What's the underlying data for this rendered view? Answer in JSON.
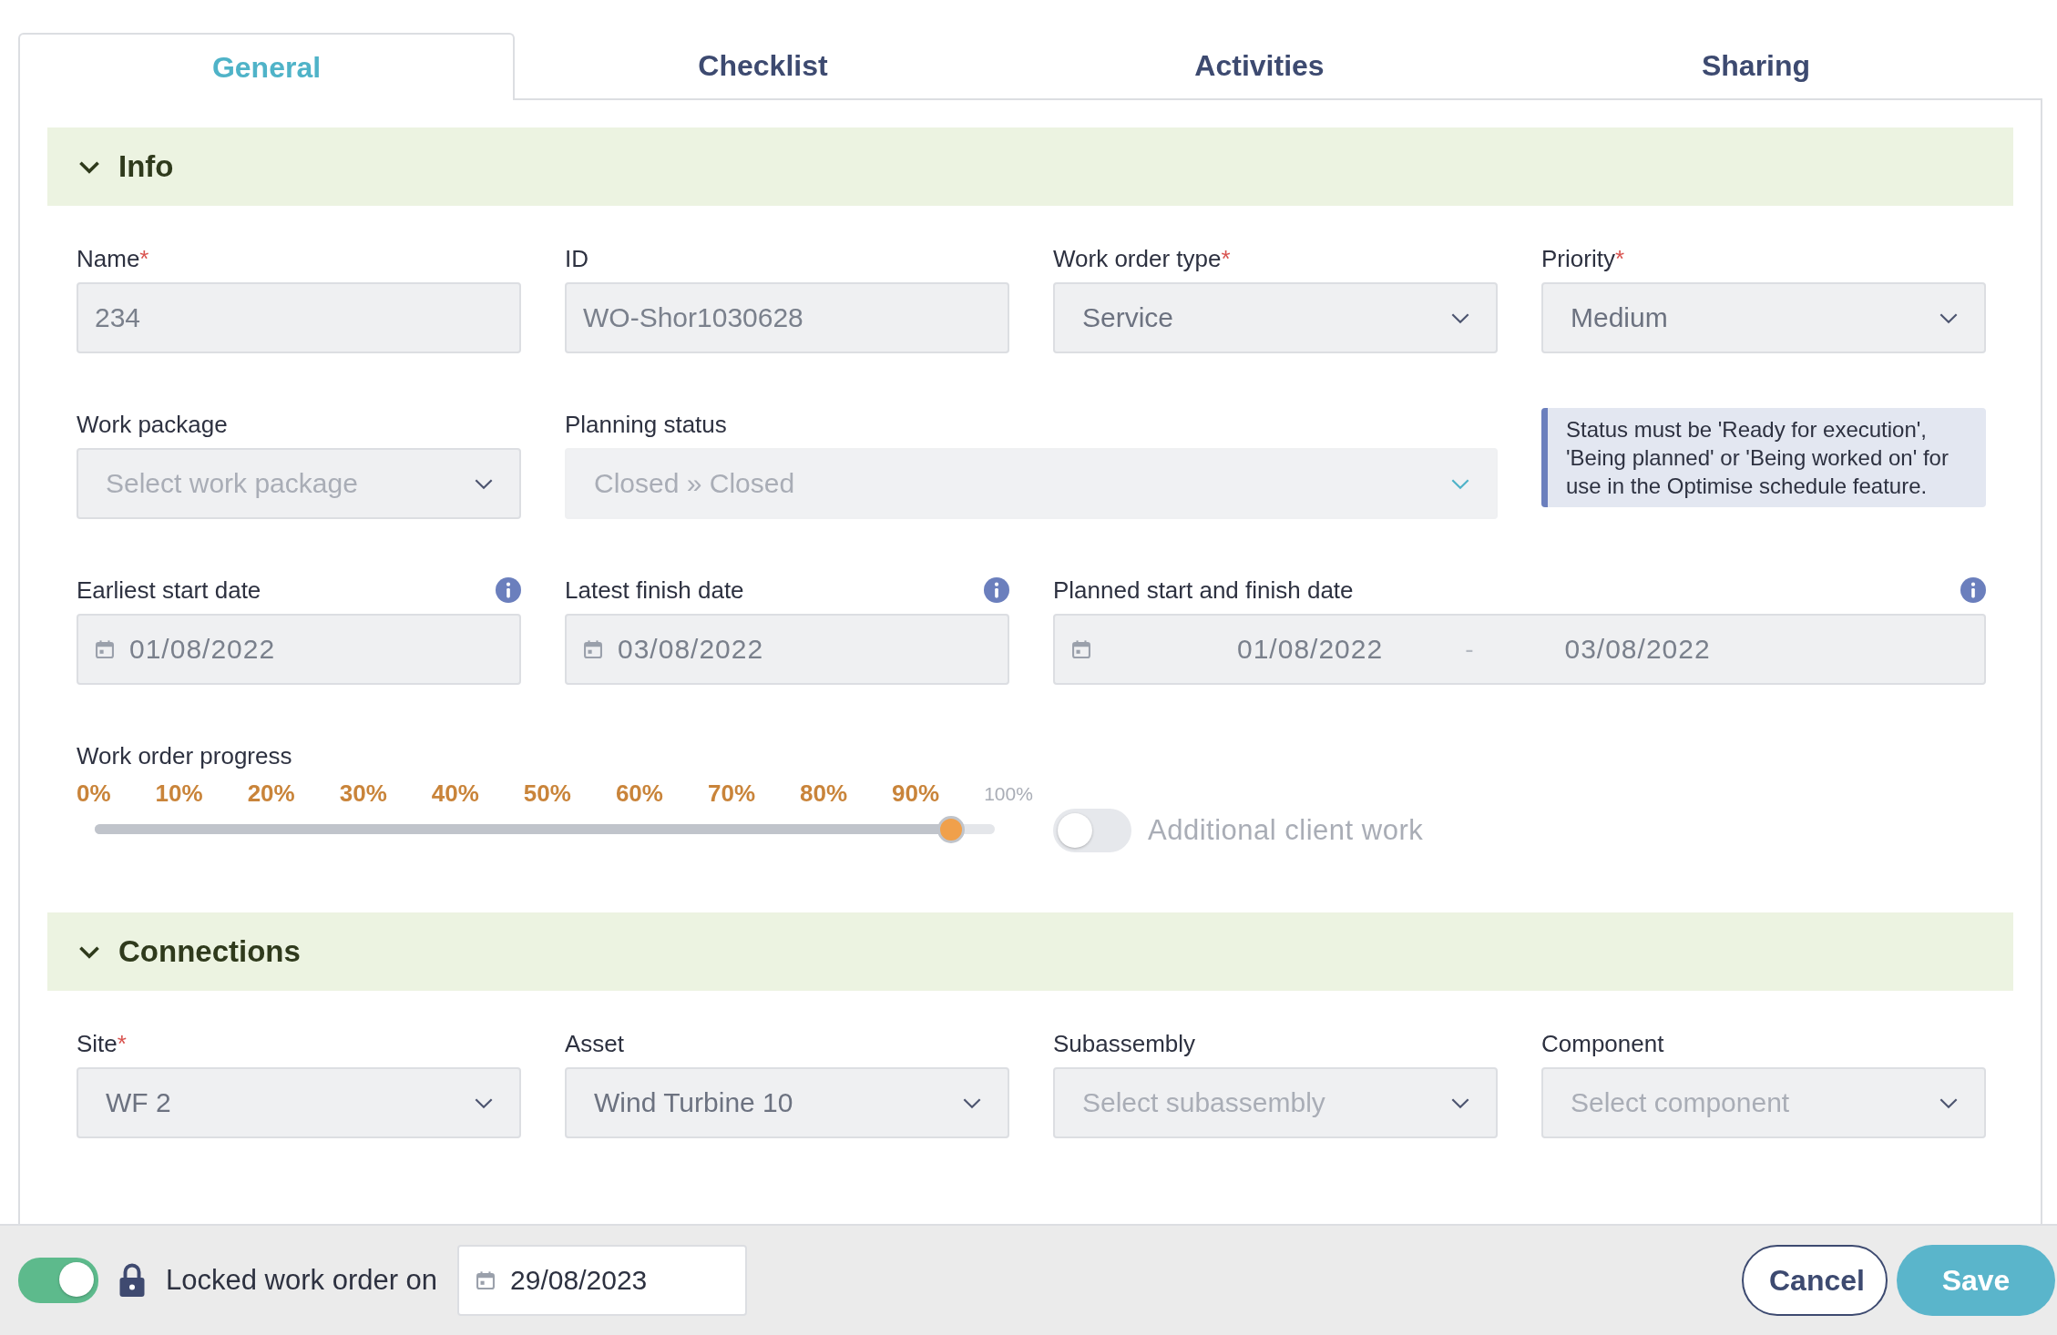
{
  "tabs": [
    {
      "label": "General",
      "selected": true
    },
    {
      "label": "Checklist",
      "selected": false
    },
    {
      "label": "Activities",
      "selected": false
    },
    {
      "label": "Sharing",
      "selected": false
    }
  ],
  "sections": [
    {
      "title": "Info",
      "expanded": true,
      "fields": [
        {
          "kind": "text",
          "label": "Name",
          "required_mark": "*",
          "value": "234"
        },
        {
          "kind": "text",
          "label": "ID",
          "value": "WO-Shor1030628"
        },
        {
          "kind": "select",
          "label": "Work order type",
          "required_mark": "*",
          "value": "Service",
          "disabled": false
        },
        {
          "kind": "select",
          "label": "Priority",
          "required_mark": "*",
          "value": "Medium",
          "disabled": false
        },
        {
          "kind": "select",
          "label": "Work package",
          "placeholder": "Select work package",
          "disabled": false
        },
        {
          "kind": "status_select",
          "label": "Planning status",
          "value": "Closed » Closed",
          "disabled": true
        },
        {
          "kind": "note",
          "text": "Status must be 'Ready for execution', 'Being planned' or 'Being worked on' for use in the Optimise schedule feature."
        },
        {
          "kind": "date",
          "label": "Earliest start date",
          "info_icon": true,
          "value": "01/08/2022"
        },
        {
          "kind": "date",
          "label": "Latest finish date",
          "info_icon": true,
          "value": "03/08/2022"
        },
        {
          "kind": "daterange",
          "label": "Planned start and finish date",
          "info_icon": true,
          "from": "01/08/2022",
          "separator": "-",
          "to": "03/08/2022"
        },
        {
          "kind": "progress",
          "label": "Work order progress",
          "level": 0.95,
          "ticks": [
            "0%",
            "10%",
            "20%",
            "30%",
            "40%",
            "50%",
            "60%",
            "70%",
            "80%",
            "90%",
            "100%"
          ]
        },
        {
          "kind": "toggle",
          "label": "Additional client work",
          "on": false
        }
      ]
    },
    {
      "title": "Connections",
      "expanded": true,
      "fields": [
        {
          "kind": "select",
          "label": "Site",
          "required_mark": "*",
          "value": "WF 2",
          "disabled": false
        },
        {
          "kind": "select",
          "label": "Asset",
          "value": "Wind Turbine 10",
          "disabled": false
        },
        {
          "kind": "select",
          "label": "Subassembly",
          "placeholder": "Select subassembly",
          "disabled": false
        },
        {
          "kind": "select",
          "label": "Component",
          "placeholder": "Select component",
          "disabled": false
        }
      ]
    }
  ],
  "footer": {
    "lock_toggle_on": true,
    "lock_label": "Locked work order on",
    "lock_date": "29/08/2023",
    "buttons": [
      {
        "kind": "secondary",
        "label": "Cancel"
      },
      {
        "kind": "primary",
        "label": "Save"
      }
    ]
  }
}
